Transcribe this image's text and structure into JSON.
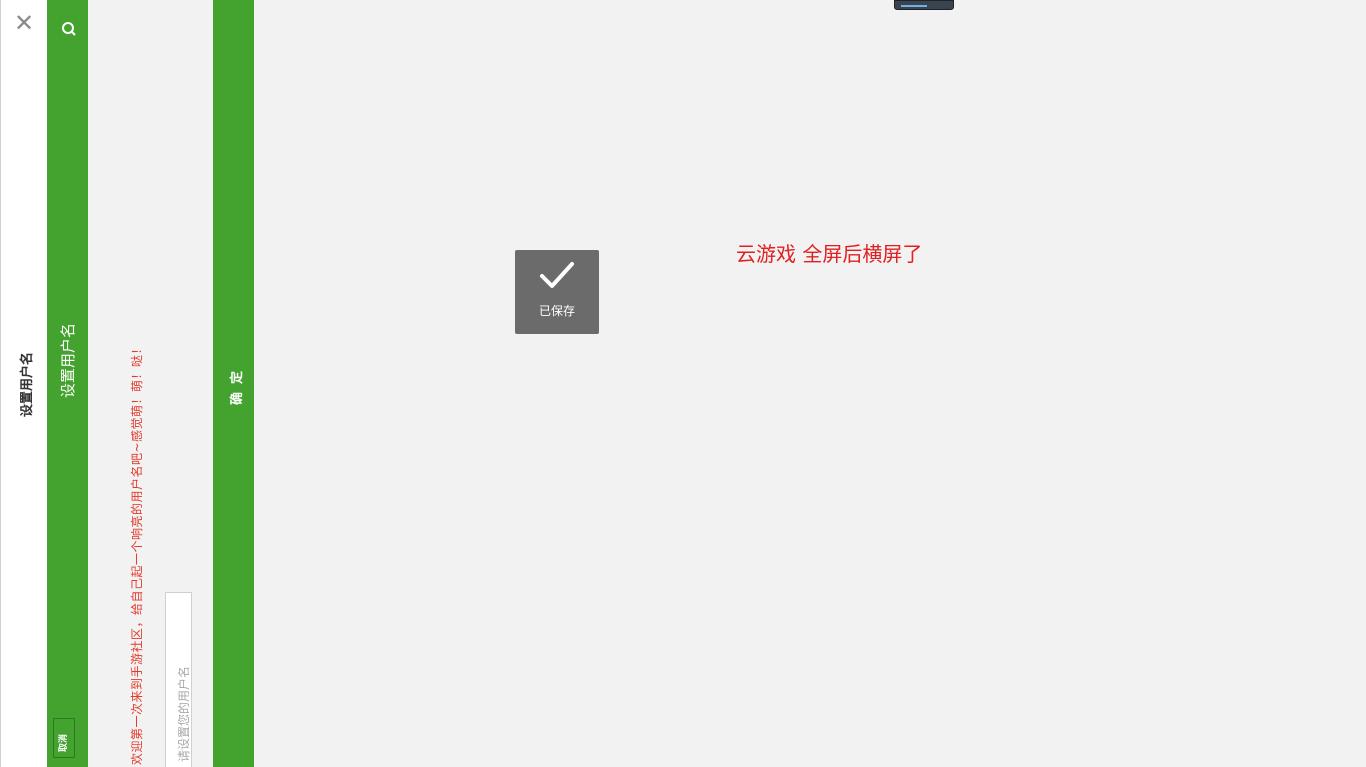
{
  "sidebar": {
    "close_glyph": "✕",
    "title": "设置用户名"
  },
  "header": {
    "title": "设置用户名",
    "cancel_label": "取消",
    "search_icon": "search-icon"
  },
  "form": {
    "welcome_text": "亲，欢迎第一次来到手游社区，给自己起一个响亮的用户名吧~感觉萌！萌！哒！",
    "name_placeholder": "请设置您的用户名",
    "name_value": "",
    "confirm_label": "确定"
  },
  "toast": {
    "icon": "check-icon",
    "text": "已保存"
  },
  "note": {
    "text": "云游戏 全屏后横屏了"
  },
  "colors": {
    "green": "#44a32f",
    "red": "#e02020",
    "toast_bg": "#6b6b6b"
  }
}
